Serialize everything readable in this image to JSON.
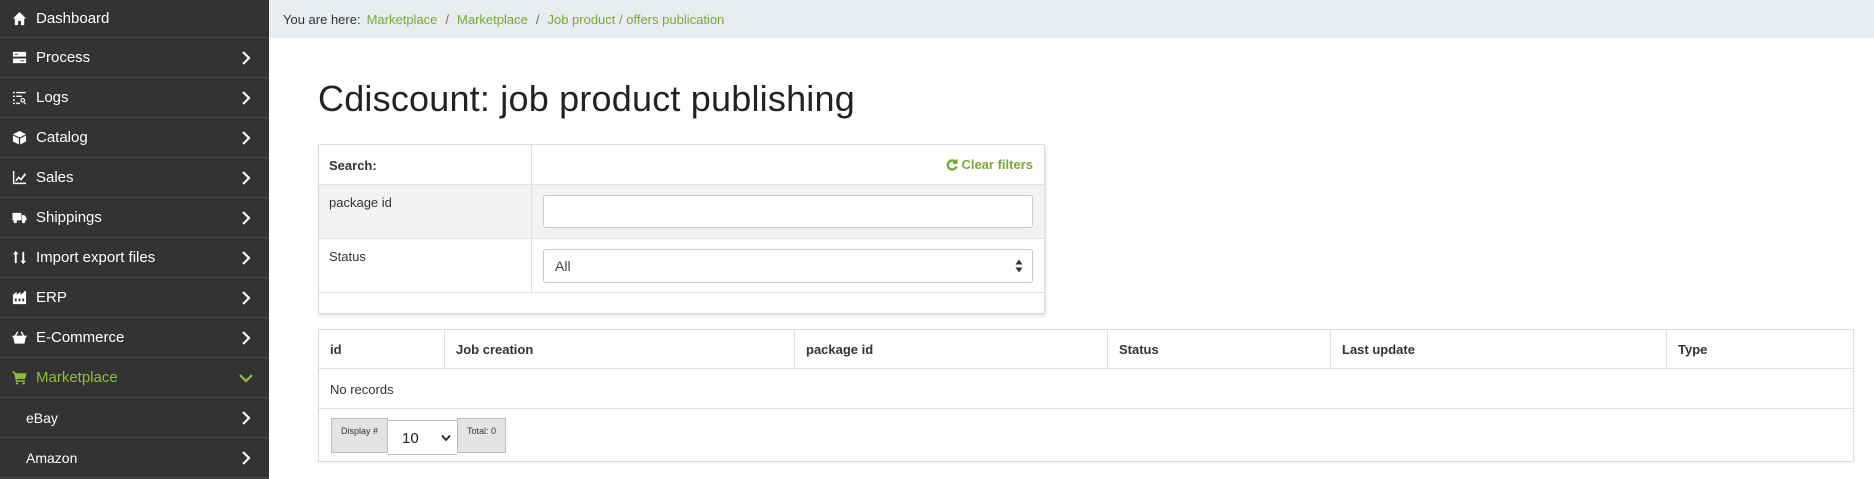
{
  "sidebar": {
    "items": [
      {
        "label": "Dashboard",
        "icon": "home-icon"
      },
      {
        "label": "Process",
        "icon": "process-icon"
      },
      {
        "label": "Logs",
        "icon": "logs-icon"
      },
      {
        "label": "Catalog",
        "icon": "box-icon"
      },
      {
        "label": "Sales",
        "icon": "chart-icon"
      },
      {
        "label": "Shippings",
        "icon": "truck-icon"
      },
      {
        "label": "Import export files",
        "icon": "import-export-icon"
      },
      {
        "label": "ERP",
        "icon": "erp-icon"
      },
      {
        "label": "E-Commerce",
        "icon": "basket-icon"
      },
      {
        "label": "Marketplace",
        "icon": "cart-icon",
        "active": true
      },
      {
        "label": "eBay"
      },
      {
        "label": "Amazon"
      }
    ],
    "active_color": "#8fbf3c"
  },
  "breadcrumb": {
    "prefix": "You are here:",
    "items": [
      "Marketplace",
      "Marketplace",
      "Job product / offers publication"
    ],
    "separator": "/"
  },
  "page": {
    "title": "Cdiscount: job product publishing"
  },
  "filters": {
    "search_label": "Search:",
    "clear_label": "Clear filters",
    "package_label": "package id",
    "package_value": "",
    "status_label": "Status",
    "status_value": "All"
  },
  "table": {
    "columns": [
      "id",
      "Job creation",
      "package id",
      "Status",
      "Last update",
      "Type"
    ],
    "empty_text": "No records"
  },
  "pager": {
    "display_label": "Display #",
    "page_size": "10",
    "total_label": "Total: 0"
  }
}
